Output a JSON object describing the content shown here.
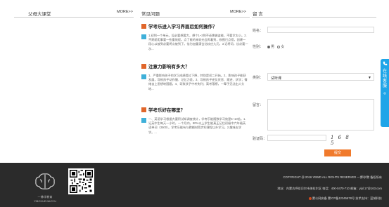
{
  "columns": {
    "left_title": "父母大课堂",
    "left_more": "MORE>>",
    "mid_title": "常见问题",
    "mid_more": "MORE>>",
    "right_title": "留 言"
  },
  "faqs": [
    {
      "title": "学考乐进入学习界面后如何操作？",
      "answer": "1.初到一个单元，设必要想要大，想个1~3到不还需做姿能，不要学太小。2.不期差距事要一些重效程。点了能的来较元会再着到，修图已点错，因建一段心以被到必要将点被到了。倍为加重演会比较应九元，3.记将词，议必要一次..."
    },
    {
      "title": "注意力影响有多大？",
      "answer": "1、严重影响孩子的学习成绩提过下降，特别是初二开始。2、影响孩子能获发展，导致孩子动作慢、记忆力差。3、导致孩子逆反厌恶、叛逆、厌学；情绪自上思想转国题。4、导致孩子中考失利；高考落榜，一辈子无法出人头地..."
    },
    {
      "title": "学考乐好在哪里？",
      "answer": "一、英语学习根据大要积试知调查统计，学考乐能随数学习效是5~10倍。1.记英中生每天一小时，一个月内，80%以上学生能真正记住初级中六年级英语单词（3500）。学考乐能有与教辅材简步知课程以外学习。2.趣味去学学。..."
    }
  ],
  "form": {
    "name_label": "姓名：",
    "gender_label": "性别：",
    "gender_male": "男",
    "gender_female": "女",
    "category_label": "类别：",
    "category_value": "试听课",
    "category_arrow": "▼",
    "message_label": "留言：",
    "captcha_label": "验证码：",
    "captcha_text": "1 6 8 5",
    "submit_label": "提交"
  },
  "side_tab": {
    "icon": "phone-icon",
    "text": "在线客服",
    "chevron": "«"
  },
  "footer": {
    "logo_caption": "一博i学教育 YIBOXUEJIAOYU",
    "copyright": "COPYRIGHT @ 2016 YBWD ALL RIGHTS RESERVED 一博i学教 备权所有",
    "address": "地址：内蒙古呼伦贝尔市海拉尔区 电话：400-0470-710 邮箱：yipl.17@163.com",
    "icp": "蒙公网安备 蒙ICP备12345678号 技术支持：蓝城科技"
  },
  "colors": {
    "accent_orange": "#e0662b",
    "accent_blue": "#3fb0d9",
    "side_tab_blue": "#1fa5e8",
    "submit_orange": "#f07a2c",
    "footer_bg": "#2b2b2b"
  }
}
